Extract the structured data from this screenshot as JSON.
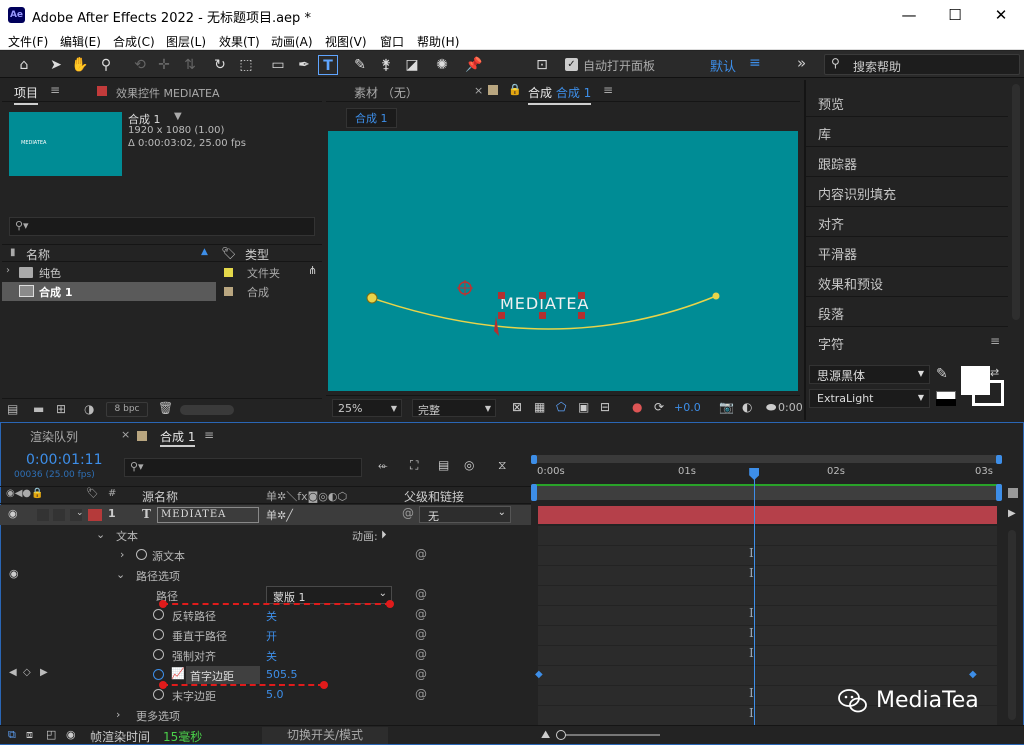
{
  "window": {
    "app_icon": "Ae",
    "title": "Adobe After Effects 2022 - 无标题项目.aep *",
    "minimize": "—",
    "maximize": "☐",
    "close": "✕"
  },
  "menu": [
    "文件(F)",
    "编辑(E)",
    "合成(C)",
    "图层(L)",
    "效果(T)",
    "动画(A)",
    "视图(V)",
    "窗口",
    "帮助(H)"
  ],
  "toolbar": {
    "auto_open_label": "自动打开面板",
    "workspace": "默认",
    "search_placeholder": "搜索帮助"
  },
  "project": {
    "tab_project": "项目",
    "tab_effects": "效果控件 MEDIATEA",
    "comp_name": "合成 1",
    "comp_res": "1920 x 1080 (1.00)",
    "comp_dur": "Δ 0:00:03:02, 25.00 fps",
    "thumb_text": "MEDIATEA",
    "col_name": "名称",
    "col_type": "类型",
    "items": [
      {
        "name": "纯色",
        "type": "文件夹",
        "color": "#e4d84a"
      },
      {
        "name": "合成 1",
        "type": "合成",
        "color": "#b9a680"
      }
    ],
    "bpc": "8 bpc"
  },
  "viewer": {
    "tab_footage": "素材 （无）",
    "tab_comp_prefix": "合成",
    "tab_comp_name": "合成 1",
    "breadcrumb": "合成 1",
    "canvas_text": "MEDIATEA",
    "zoom": "25%",
    "quality": "完整",
    "exposure": "+0.0",
    "timecode": "0:00",
    "bg_color": "#008c95"
  },
  "right_panels": [
    "预览",
    "库",
    "跟踪器",
    "内容识别填充",
    "对齐",
    "平滑器",
    "效果和预设",
    "段落",
    "字符"
  ],
  "character": {
    "font": "思源黑体",
    "style": "ExtraLight"
  },
  "timeline": {
    "tab_render": "渲染队列",
    "tab_comp": "合成 1",
    "timecode": "0:00:01:11",
    "frame_info": "00036 (25.00 fps)",
    "col_source": "源名称",
    "col_switches": "单✲＼fx◙◎◐⬡",
    "col_parent": "父级和链接",
    "layer": {
      "index": "1",
      "type": "T",
      "name": "MEDIATEA",
      "parent": "无",
      "color": "#b53a3a"
    },
    "props": {
      "text": "文本",
      "animate": "动画:",
      "source_text": "源文本",
      "path_options": "路径选项",
      "path": "路径",
      "path_value": "蒙版 1",
      "reverse": "反转路径",
      "reverse_val": "关",
      "perpendicular": "垂直于路径",
      "perpendicular_val": "开",
      "force_align": "强制对齐",
      "force_align_val": "关",
      "first_margin": "首字边距",
      "first_margin_val": "505.5",
      "last_margin": "末字边距",
      "last_margin_val": "5.0",
      "more_options": "更多选项"
    },
    "ruler": [
      "0:00s",
      "01s",
      "02s",
      "03s"
    ],
    "playhead": 0.471,
    "footer_render_label": "帧渲染时间",
    "footer_render_value": "15毫秒",
    "footer_toggle": "切换开关/模式"
  },
  "watermark": "MediaTea"
}
